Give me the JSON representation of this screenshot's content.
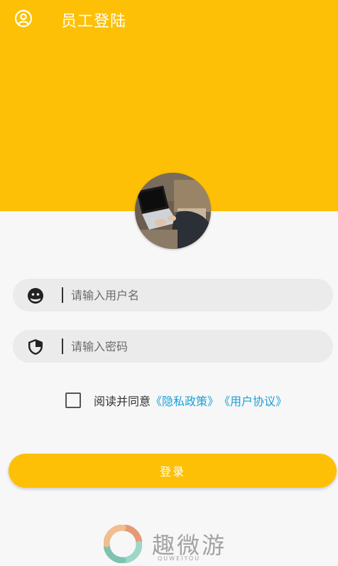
{
  "header": {
    "title": "员工登陆",
    "user_icon": "user-circle-icon",
    "background": "#fdc006"
  },
  "avatar": {
    "alt": "laptop photo avatar"
  },
  "username": {
    "placeholder": "请输入用户名",
    "value": "",
    "icon": "user-face-icon"
  },
  "password": {
    "placeholder": "请输入密码",
    "value": "",
    "icon": "shield-icon"
  },
  "agreement": {
    "checked": false,
    "text": "阅读并同意",
    "privacy_link": "《隐私政策》",
    "user_link": "《用户协议》",
    "link_color": "#1aa0d8"
  },
  "login": {
    "label": "登录"
  },
  "watermark": {
    "brand": "趣微游",
    "sub": "QUWEIYOU"
  }
}
